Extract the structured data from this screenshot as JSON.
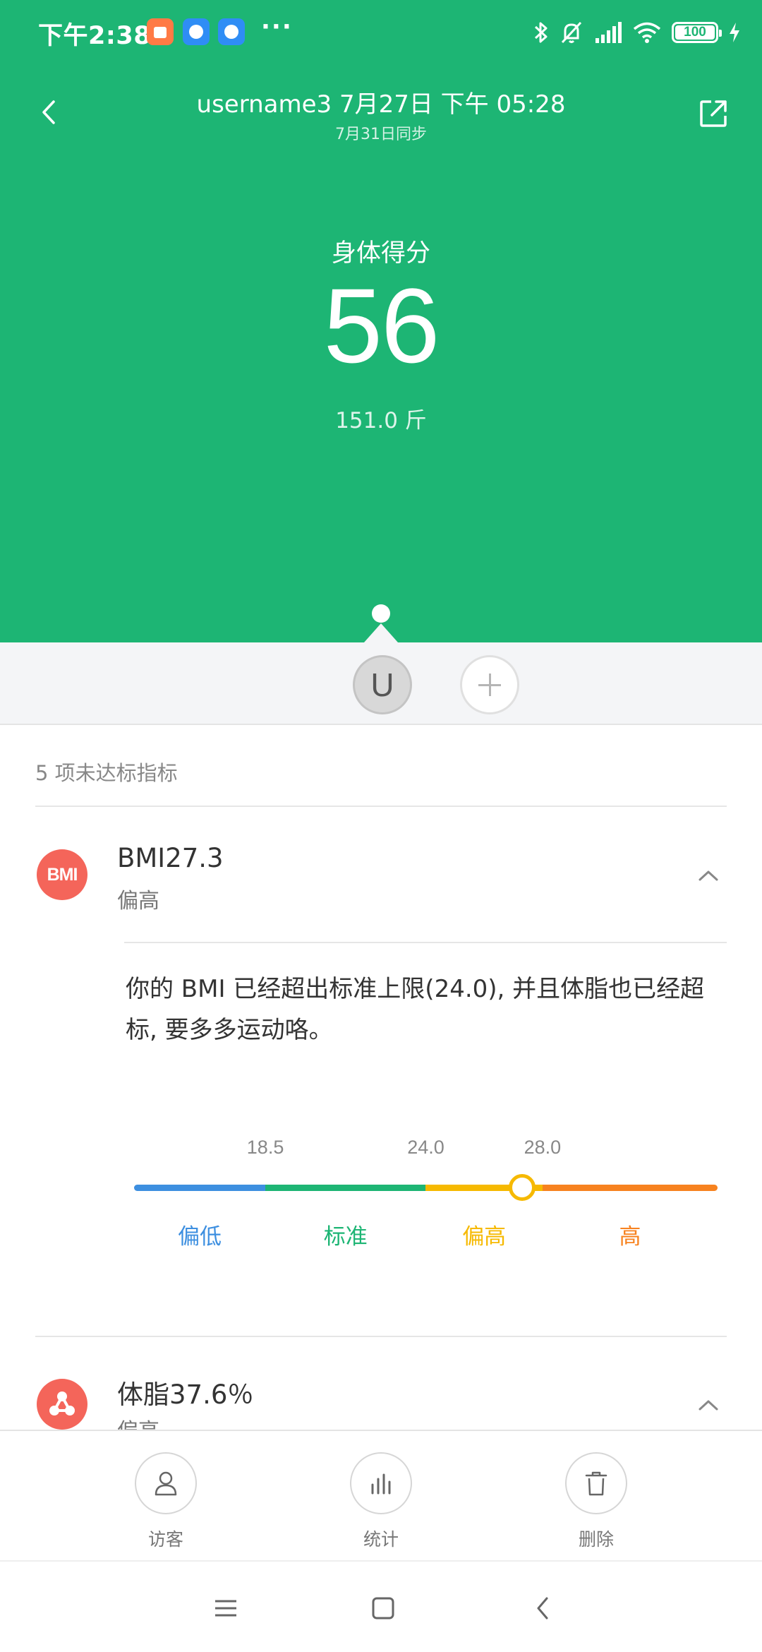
{
  "status_bar": {
    "time": "下午2:38",
    "more": "···",
    "battery": "100"
  },
  "header": {
    "title": "username3 7月27日 下午 05:28",
    "subtitle": "7月31日同步",
    "score_label": "身体得分",
    "score": "56",
    "weight": "151.0 斤"
  },
  "user": {
    "avatar_letter": "U"
  },
  "section": {
    "title": "5 项未达标指标"
  },
  "bmi": {
    "icon_text": "BMI",
    "title": "BMI27.3",
    "status": "偏高",
    "advice": "你的 BMI 已经超出标准上限(24.0), 并且体脂也已经超标, 要多多运动咯。",
    "value": 27.3,
    "scale": {
      "min": 14.0,
      "max": 34.0,
      "thresholds": [
        "18.5",
        "24.0",
        "28.0"
      ],
      "ranges": [
        {
          "label": "偏低",
          "color": "#3d8fe0"
        },
        {
          "label": "标准",
          "color": "#1db574"
        },
        {
          "label": "偏高",
          "color": "#f6b900"
        },
        {
          "label": "高",
          "color": "#f7821f"
        }
      ]
    }
  },
  "body_fat": {
    "title": "体脂37.6％",
    "status": "偏高"
  },
  "actions": {
    "visitor": "访客",
    "stats": "统计",
    "delete": "删除"
  },
  "colors": {
    "brand_green": "#1db574",
    "metric_red": "#f4655a"
  }
}
